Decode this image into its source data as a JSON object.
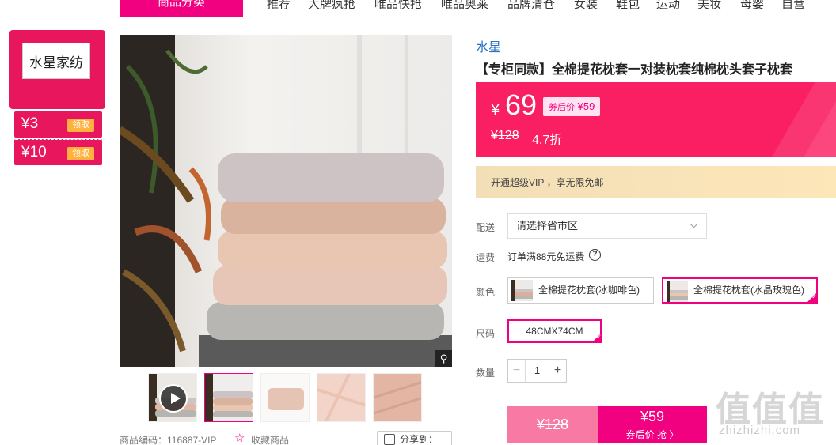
{
  "nav": {
    "category_button": "商品分类",
    "items": [
      "推荐",
      "大牌疯抢",
      "唯品快抢",
      "唯品奥莱",
      "品牌清仓",
      "女装",
      "鞋包",
      "运动",
      "美妆",
      "母婴",
      "自营"
    ]
  },
  "shop": {
    "logo_text": "水星家纺",
    "coupons": [
      {
        "amount": "¥3",
        "action": "领取"
      },
      {
        "amount": "¥10",
        "action": "领取"
      }
    ]
  },
  "gallery": {
    "thumbnails": [
      "video",
      "pillow-stack",
      "pillow-single",
      "fabric-detail-1",
      "fabric-detail-2"
    ],
    "active_index": 1,
    "zoom_icon": "magnifier-icon"
  },
  "meta": {
    "product_code": "商品编码：116887-VIP",
    "favorite": "收藏商品",
    "share": "分享到："
  },
  "product": {
    "brand": "水星",
    "title": "【专柜同款】全棉提花枕套一对装枕套纯棉枕头套子枕套",
    "price_symbol": "¥",
    "price": "69",
    "after_coupon_label": "券后价",
    "after_coupon_price": "¥59",
    "original_price": "¥128",
    "discount": "4.7折",
    "vip_text": "开通超级VIP ，享无限免邮"
  },
  "delivery": {
    "label": "配送",
    "placeholder": "请选择省市区"
  },
  "shipping": {
    "label": "运费",
    "text": "订单满88元免运费"
  },
  "color": {
    "label": "颜色",
    "options": [
      "全棉提花枕套(冰咖啡色)",
      "全棉提花枕套(水晶玫瑰色)"
    ],
    "selected_index": 1
  },
  "size": {
    "label": "尺码",
    "options": [
      "48CMX74CM"
    ],
    "selected_index": 0
  },
  "quantity": {
    "label": "数量",
    "value": "1",
    "minus": "−",
    "plus": "+"
  },
  "buy": {
    "original_price": "¥128",
    "coupon_price": "¥59",
    "coupon_label": "券后价 抢 〉"
  },
  "watermark": {
    "big": "值值值",
    "url": "zhizhizhi.com"
  },
  "colors": {
    "accent": "#f10180",
    "price_bg": "#fa1f62",
    "brand_link": "#2b73c6",
    "coupon_btn": "#ffb13d"
  }
}
